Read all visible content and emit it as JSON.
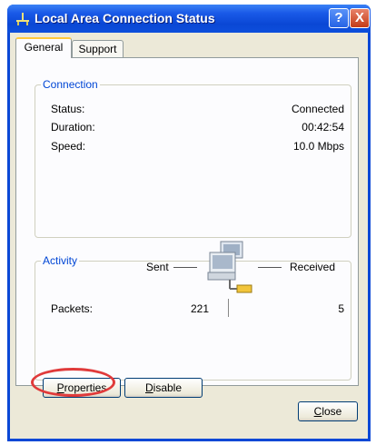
{
  "window": {
    "title": "Local Area Connection Status",
    "help_label": "?",
    "close_label": "X"
  },
  "tabs": [
    {
      "label": "General",
      "selected": true
    },
    {
      "label": "Support",
      "selected": false
    }
  ],
  "connection": {
    "group_title": "Connection",
    "status_label": "Status:",
    "status_value": "Connected",
    "duration_label": "Duration:",
    "duration_value": "00:42:54",
    "speed_label": "Speed:",
    "speed_value": "10.0 Mbps"
  },
  "activity": {
    "group_title": "Activity",
    "sent_label": "Sent",
    "received_label": "Received",
    "packets_label": "Packets:",
    "packets_sent": "221",
    "packets_received": "5"
  },
  "buttons": {
    "properties_label": "Properties",
    "properties_mnemonic": "P",
    "properties_rest": "roperties",
    "disable_label": "Disable",
    "disable_mnemonic": "D",
    "disable_rest": "isable",
    "close_label": "Close",
    "close_mnemonic": "C",
    "close_rest": "lose"
  },
  "colors": {
    "titlebar": "#0a47d5",
    "accent_group_title": "#0046d5",
    "highlight_ring": "#e03a3a"
  },
  "icons": {
    "title": "network-connection-icon",
    "activity": "network-computers-icon"
  }
}
